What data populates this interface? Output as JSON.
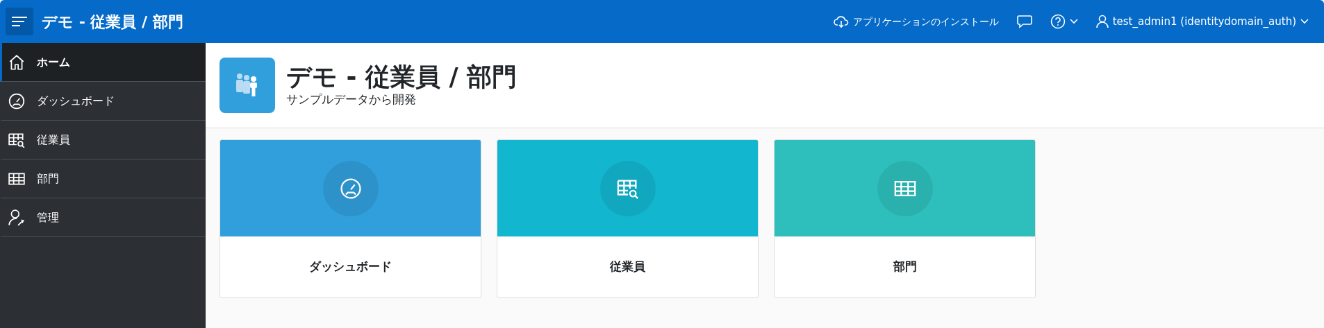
{
  "header": {
    "title": "デモ - 従業員 / 部門",
    "install": "アプリケーションのインストール",
    "user": "test_admin1 (identitydomain_auth)"
  },
  "sidebar": {
    "items": [
      {
        "label": "ホーム",
        "selected": true
      },
      {
        "label": "ダッシュボード",
        "selected": false
      },
      {
        "label": "従業員",
        "selected": false
      },
      {
        "label": "部門",
        "selected": false
      },
      {
        "label": "管理",
        "selected": false
      }
    ]
  },
  "page": {
    "title": "デモ - 従業員 / 部門",
    "subtitle": "サンプルデータから開発"
  },
  "cards": [
    {
      "label": "ダッシュボード",
      "color": "#309fdb"
    },
    {
      "label": "従業員",
      "color": "#13b6cf"
    },
    {
      "label": "部門",
      "color": "#2ebfbc"
    }
  ]
}
